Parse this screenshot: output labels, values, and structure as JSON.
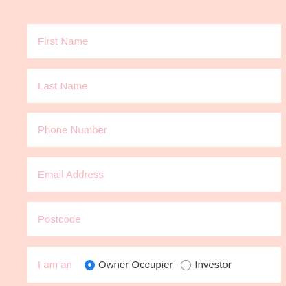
{
  "form": {
    "first_name": {
      "placeholder": "First Name",
      "value": ""
    },
    "last_name": {
      "placeholder": "Last Name",
      "value": ""
    },
    "phone": {
      "placeholder": "Phone Number",
      "value": ""
    },
    "email": {
      "placeholder": "Email Address",
      "value": ""
    },
    "postcode": {
      "placeholder": "Postcode",
      "value": ""
    },
    "buyer_type": {
      "label": "I am an",
      "options": [
        {
          "label": "Owner Occupier",
          "selected": true
        },
        {
          "label": "Investor",
          "selected": false
        }
      ]
    }
  },
  "colors": {
    "background": "#FFDCD4",
    "field": "#FFFFFF",
    "placeholder": "#F7B7C0",
    "accent": "#1E7CEA"
  }
}
